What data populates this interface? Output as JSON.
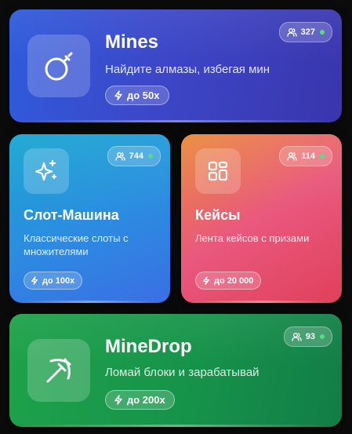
{
  "colors": {
    "online_dot": "#4ade80"
  },
  "games": {
    "mines": {
      "title": "Mines",
      "description": "Найдите алмазы, избегая мин",
      "multiplier": "до 50x",
      "players": "327",
      "icon": "bomb-icon"
    },
    "slot": {
      "title": "Слот-Машина",
      "description": "Классические слоты с множителями",
      "multiplier": "до 100x",
      "players": "744",
      "icon": "sparkles-icon"
    },
    "cases": {
      "title": "Кейсы",
      "description": "Лента кейсов с призами",
      "multiplier": "до 20 000",
      "players": "114",
      "icon": "grid-icon"
    },
    "minedrop": {
      "title": "MineDrop",
      "description": "Ломай блоки и зарабатывай",
      "multiplier": "до 200x",
      "players": "93",
      "icon": "pickaxe-icon"
    }
  }
}
